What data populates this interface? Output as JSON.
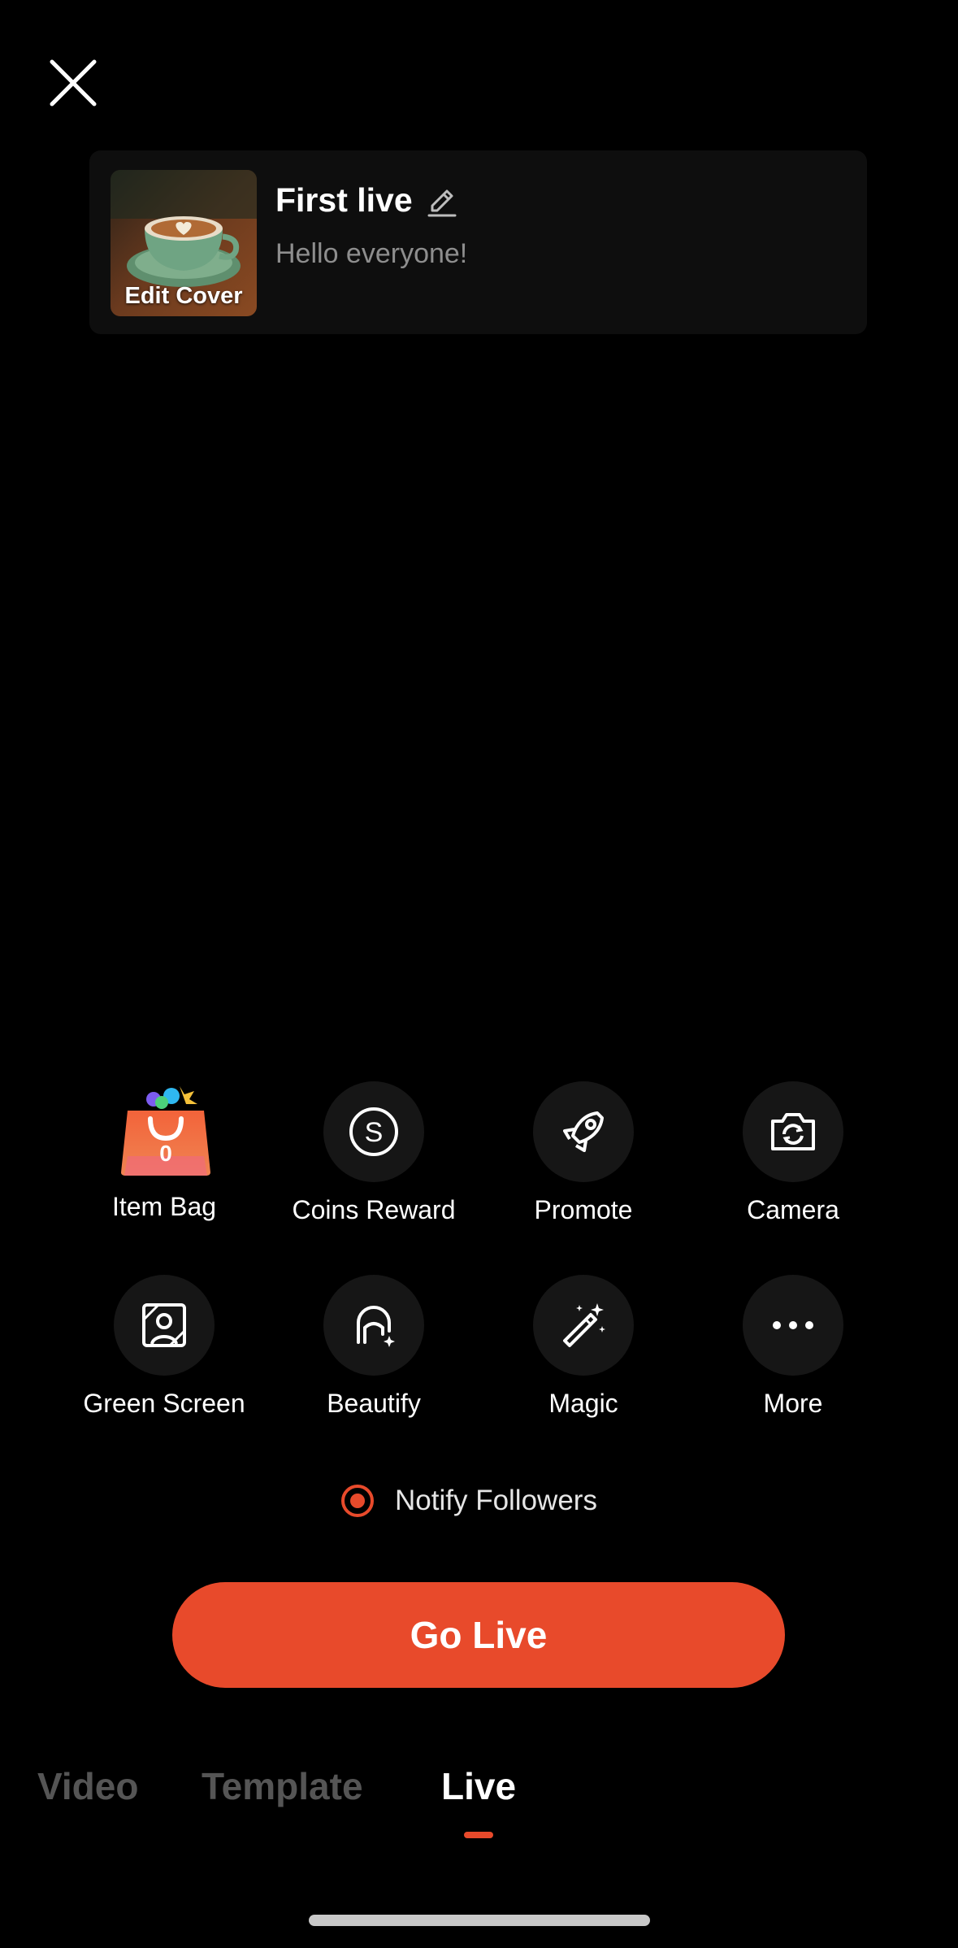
{
  "header": {
    "close_icon": "close-icon"
  },
  "live_card": {
    "cover_label": "Edit Cover",
    "title": "First live",
    "description": "Hello everyone!",
    "edit_icon": "pencil-icon"
  },
  "tools": [
    {
      "label": "Item Bag",
      "icon": "shopping-bag-icon",
      "badge": "0"
    },
    {
      "label": "Coins Reward",
      "icon": "coin-icon"
    },
    {
      "label": "Promote",
      "icon": "rocket-icon"
    },
    {
      "label": "Camera",
      "icon": "camera-flip-icon"
    },
    {
      "label": "Green Screen",
      "icon": "green-screen-icon"
    },
    {
      "label": "Beautify",
      "icon": "beautify-icon"
    },
    {
      "label": "Magic",
      "icon": "magic-wand-icon"
    },
    {
      "label": "More",
      "icon": "more-dots-icon"
    }
  ],
  "notify": {
    "label": "Notify Followers",
    "checked": true
  },
  "go_live": {
    "label": "Go Live"
  },
  "tabs": [
    {
      "label": "Video",
      "active": false
    },
    {
      "label": "Template",
      "active": false
    },
    {
      "label": "Live",
      "active": true
    }
  ],
  "colors": {
    "accent": "#e84a2b",
    "background": "#000000",
    "muted": "#555555"
  }
}
